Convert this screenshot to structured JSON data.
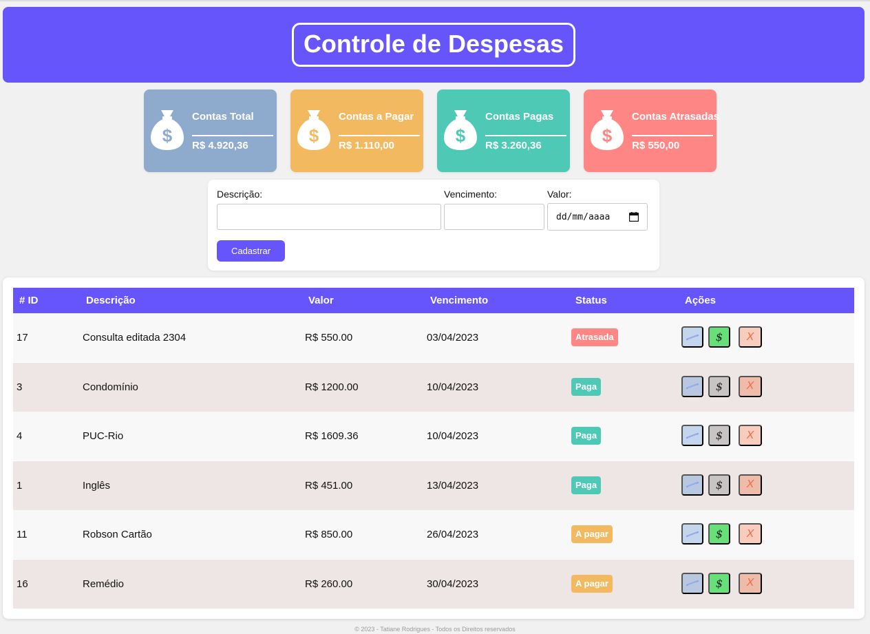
{
  "header": {
    "title": "Controle de Despesas"
  },
  "cards": [
    {
      "title": "Contas Total",
      "value": "R$ 4.920,36",
      "color": "#8eabcd"
    },
    {
      "title": "Contas a Pagar",
      "value": "R$ 1.110,00",
      "color": "#f3b960"
    },
    {
      "title": "Contas Pagas",
      "value": "R$ 3.260,36",
      "color": "#4ec9b6"
    },
    {
      "title": "Contas Atrasadas",
      "value": "R$ 550,00",
      "color": "#fe8786"
    }
  ],
  "form": {
    "description_label": "Descrição:",
    "description_value": "",
    "due_label": "Vencimento:",
    "due_value": "",
    "value_label": "Valor:",
    "date_placeholder": "dd/mm/aaaa",
    "submit_label": "Cadastrar"
  },
  "table": {
    "headers": [
      "# ID",
      "Descrição",
      "Valor",
      "Vencimento",
      "Status",
      "Ações"
    ],
    "rows": [
      {
        "id": "17",
        "description": "Consulta editada 2304",
        "value": "R$ 550.00",
        "due": "03/04/2023",
        "status": "Atrasada",
        "status_color": "#fe8786",
        "pay_enabled": true
      },
      {
        "id": "3",
        "description": "Condomínio",
        "value": "R$ 1200.00",
        "due": "10/04/2023",
        "status": "Paga",
        "status_color": "#4ec9b6",
        "pay_enabled": false
      },
      {
        "id": "4",
        "description": "PUC-Rio",
        "value": "R$ 1609.36",
        "due": "10/04/2023",
        "status": "Paga",
        "status_color": "#4ec9b6",
        "pay_enabled": false
      },
      {
        "id": "1",
        "description": "Inglês",
        "value": "R$ 451.00",
        "due": "13/04/2023",
        "status": "Paga",
        "status_color": "#4ec9b6",
        "pay_enabled": false
      },
      {
        "id": "11",
        "description": "Robson Cartão",
        "value": "R$ 850.00",
        "due": "26/04/2023",
        "status": "A pagar",
        "status_color": "#f3b960",
        "pay_enabled": true
      },
      {
        "id": "16",
        "description": "Remédio",
        "value": "R$ 260.00",
        "due": "30/04/2023",
        "status": "A pagar",
        "status_color": "#f3b960",
        "pay_enabled": true
      }
    ],
    "actions": {
      "edit_icon": "pencil-icon",
      "pay_symbol": "$",
      "delete_symbol": "X"
    }
  },
  "colors": {
    "accent": "#6655fb",
    "pay_enabled": "#67e07a",
    "pay_disabled": "#c9c4c4",
    "delete": "#f36a45"
  },
  "footer": {
    "text": "© 2023 - Tatiane Rodrigues - Todos os Direitos reservados"
  }
}
